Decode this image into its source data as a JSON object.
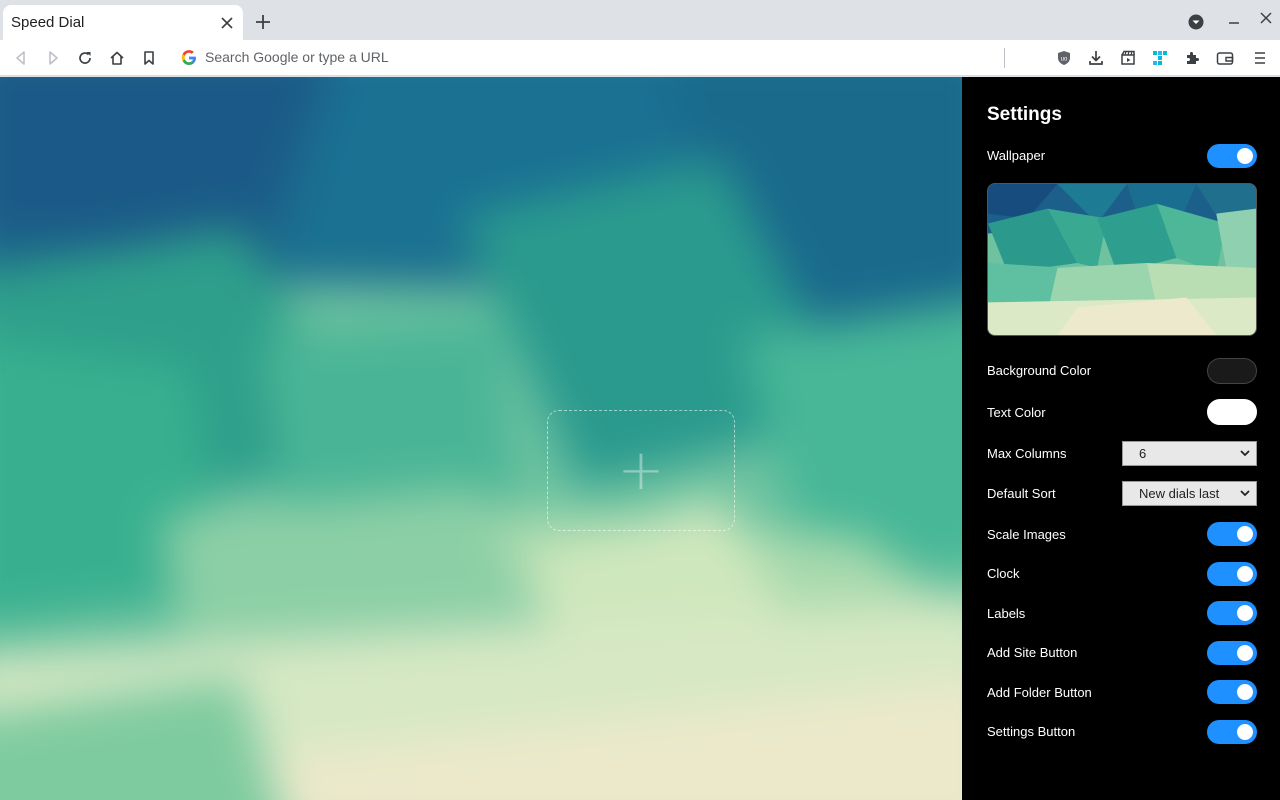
{
  "browser": {
    "tab_title": "Speed Dial",
    "omnibox_placeholder": "Search Google or type a URL"
  },
  "icons": {
    "back": "arrow-left-icon",
    "forward": "arrow-right-icon",
    "reload": "reload-icon",
    "home": "home-icon",
    "bookmark": "bookmark-icon",
    "google": "google-icon",
    "ublock": "shield-icon",
    "download": "download-icon",
    "clapper": "clapperboard-icon",
    "extension_colorful": "puzzle-color-icon",
    "extensions": "puzzle-icon",
    "wallet": "wallet-icon",
    "menu": "menu-icon"
  },
  "settings": {
    "title": "Settings",
    "wallpaper": {
      "label": "Wallpaper",
      "on": true
    },
    "background_color": {
      "label": "Background Color",
      "value": "#1a1a1a"
    },
    "text_color": {
      "label": "Text Color",
      "value": "#ffffff"
    },
    "max_columns": {
      "label": "Max Columns",
      "value": "6"
    },
    "default_sort": {
      "label": "Default Sort",
      "value": "New dials last"
    },
    "scale_images": {
      "label": "Scale Images",
      "on": true
    },
    "clock": {
      "label": "Clock",
      "on": true
    },
    "labels": {
      "label": "Labels",
      "on": true
    },
    "add_site_button": {
      "label": "Add Site Button",
      "on": true
    },
    "add_folder_button": {
      "label": "Add Folder Button",
      "on": true
    },
    "settings_button": {
      "label": "Settings Button",
      "on": true
    }
  },
  "colors": {
    "toggle_on": "#1e90ff",
    "panel_bg": "#000000"
  }
}
